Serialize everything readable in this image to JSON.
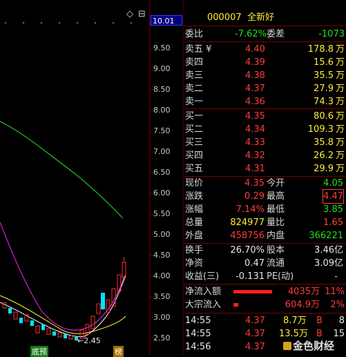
{
  "header": {
    "price_box": "10.01",
    "stock_code": "000007",
    "stock_name": "全新好",
    "diamond_icon": "◇",
    "collapse_icon": "⊟"
  },
  "chart": {
    "axis_ticks": [
      "10.01",
      "9.50",
      "9.00",
      "8.50",
      "8.00",
      "7.50",
      "7.00",
      "6.50",
      "6.00",
      "5.50",
      "5.00",
      "4.50",
      "4.00",
      "3.50",
      "3.00",
      "2.50"
    ],
    "low_marker": "2.45",
    "badges": [
      "底预",
      "榜"
    ],
    "colors": {
      "up": "#ff3030",
      "down": "#00e5ff",
      "ma_green": "#22cc22",
      "ma_magenta": "#d020d0",
      "ma_yellow": "#eeee33",
      "ma_white": "#ffffff"
    }
  },
  "commission": {
    "ratio_label": "委比",
    "ratio_value": "-7.62%",
    "diff_label": "委差",
    "diff_value": "-1073"
  },
  "sell_orders": [
    {
      "label": "卖五 ¥",
      "price": "4.40",
      "vol": "178.8",
      "unit": "万"
    },
    {
      "label": "卖四",
      "price": "4.39",
      "vol": "15.6",
      "unit": "万"
    },
    {
      "label": "卖三",
      "price": "4.38",
      "vol": "35.5",
      "unit": "万"
    },
    {
      "label": "卖二",
      "price": "4.37",
      "vol": "27.9",
      "unit": "万"
    },
    {
      "label": "卖一",
      "price": "4.36",
      "vol": "74.3",
      "unit": "万"
    }
  ],
  "buy_orders": [
    {
      "label": "买一",
      "price": "4.35",
      "vol": "80.6",
      "unit": "万"
    },
    {
      "label": "买二",
      "price": "4.34",
      "vol": "109.3",
      "unit": "万"
    },
    {
      "label": "买三",
      "price": "4.33",
      "vol": "35.8",
      "unit": "万"
    },
    {
      "label": "买四",
      "price": "4.32",
      "vol": "26.2",
      "unit": "万"
    },
    {
      "label": "买五",
      "price": "4.31",
      "vol": "29.9",
      "unit": "万"
    }
  ],
  "quote": [
    {
      "l1": "现价",
      "v1": "4.35",
      "l2": "今开",
      "v2": "4.05"
    },
    {
      "l1": "涨跌",
      "v1": "0.29",
      "l2": "最高",
      "v2": "4.47"
    },
    {
      "l1": "涨幅",
      "v1": "7.14%",
      "l2": "最低",
      "v2": "3.85"
    },
    {
      "l1": "总量",
      "v1": "824977",
      "l2": "量比",
      "v2": "1.65"
    },
    {
      "l1": "外盘",
      "v1": "458756",
      "l2": "内盘",
      "v2": "366221"
    }
  ],
  "fundamentals": [
    {
      "l1": "换手",
      "v1": "26.70%",
      "l2": "股本",
      "v2": "3.46亿"
    },
    {
      "l1": "净资",
      "v1": "0.47",
      "l2": "流通",
      "v2": "3.09亿"
    },
    {
      "l1": "收益(三)",
      "v1": "-0.131",
      "l2": "PE(动)",
      "v2": "-"
    }
  ],
  "flows": [
    {
      "label": "净流入额",
      "amount": "4035万",
      "pct": "11%",
      "bar": 0.95
    },
    {
      "label": "大宗流入",
      "amount": "604.9万",
      "pct": "2%",
      "bar": 0.12
    }
  ],
  "ticks": [
    {
      "time": "14:55",
      "price": "4.37",
      "vol": "8.7万",
      "side": "B",
      "n": "8"
    },
    {
      "time": "14:55",
      "price": "4.37",
      "vol": "13.5万",
      "side": "B",
      "n": "15"
    },
    {
      "time": "14:56",
      "price": "4.37",
      "vol": "",
      "side": "",
      "n": ""
    }
  ],
  "watermark": "金色财经"
}
